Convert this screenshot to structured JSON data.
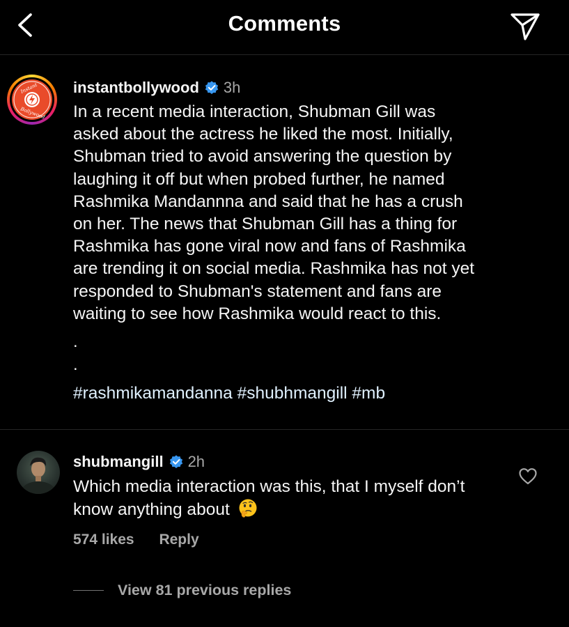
{
  "header": {
    "title": "Comments",
    "back_icon": "chevron-left-icon",
    "share_icon": "paper-plane-icon"
  },
  "post": {
    "username": "instantbollywood",
    "time": "3h",
    "verified": true,
    "avatar_logo_text": "Instant Bollywood",
    "caption": "In a recent media interaction, Shubman Gill was\nasked about the actress he liked the most. Initially,\nShubman tried to avoid answering the question by\nlaughing it off but when probed further, he named\nRashmika Mandannna and said that he has a crush\non her. The news that Shubman Gill has a thing for\nRashmika has gone viral now and fans of Rashmika\nare trending it on social media. Rashmika has not yet\nresponded to Shubman's statement and fans are\nwaiting to see how Rashmika would react to this.",
    "dot_1": ".",
    "dot_2": ".",
    "hashtags": "#rashmikamandanna #shubhmangill #mb"
  },
  "comment": {
    "username": "shubmangill",
    "time": "2h",
    "verified": true,
    "text": "Which media interaction was this, that I myself don’t know anything about",
    "emoji": "thinking-face-emoji",
    "likes": "574 likes",
    "reply_label": "Reply",
    "view_replies": "View 81 previous replies"
  },
  "colors": {
    "background": "#000000",
    "text_primary": "#f5f5f5",
    "text_secondary": "#a8a8a8",
    "verified_blue": "#3897f0",
    "hashtag": "#e0f1ff",
    "divider": "#262626"
  }
}
